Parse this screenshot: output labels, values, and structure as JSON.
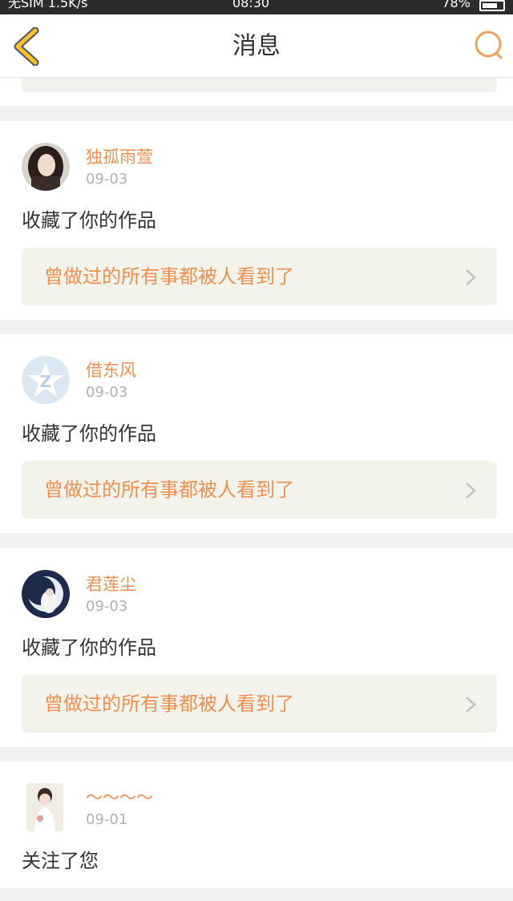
{
  "status_bar": {
    "carrier": "无SIM 1.5K/s",
    "time": "08:30",
    "battery": "78%"
  },
  "nav": {
    "title": "消息",
    "back_icon": "chevron-left-icon",
    "search_icon": "search-icon",
    "accent_color": "#f2b32b"
  },
  "messages": [
    {
      "username": "独孤雨萱",
      "date": "09-03",
      "action": "收藏了你的作品",
      "quote": "曾做过的所有事都被人看到了"
    },
    {
      "username": "借东风",
      "date": "09-03",
      "action": "收藏了你的作品",
      "quote": "曾做过的所有事都被人看到了"
    },
    {
      "username": "君莲尘",
      "date": "09-03",
      "action": "收藏了你的作品",
      "quote": "曾做过的所有事都被人看到了"
    },
    {
      "username": "～～～～",
      "date": "09-01",
      "action": "关注了您",
      "quote": ""
    }
  ],
  "colors": {
    "name": "#ee8f4e",
    "quote_bg": "#f3f3ec",
    "date": "#b0b0b0"
  }
}
